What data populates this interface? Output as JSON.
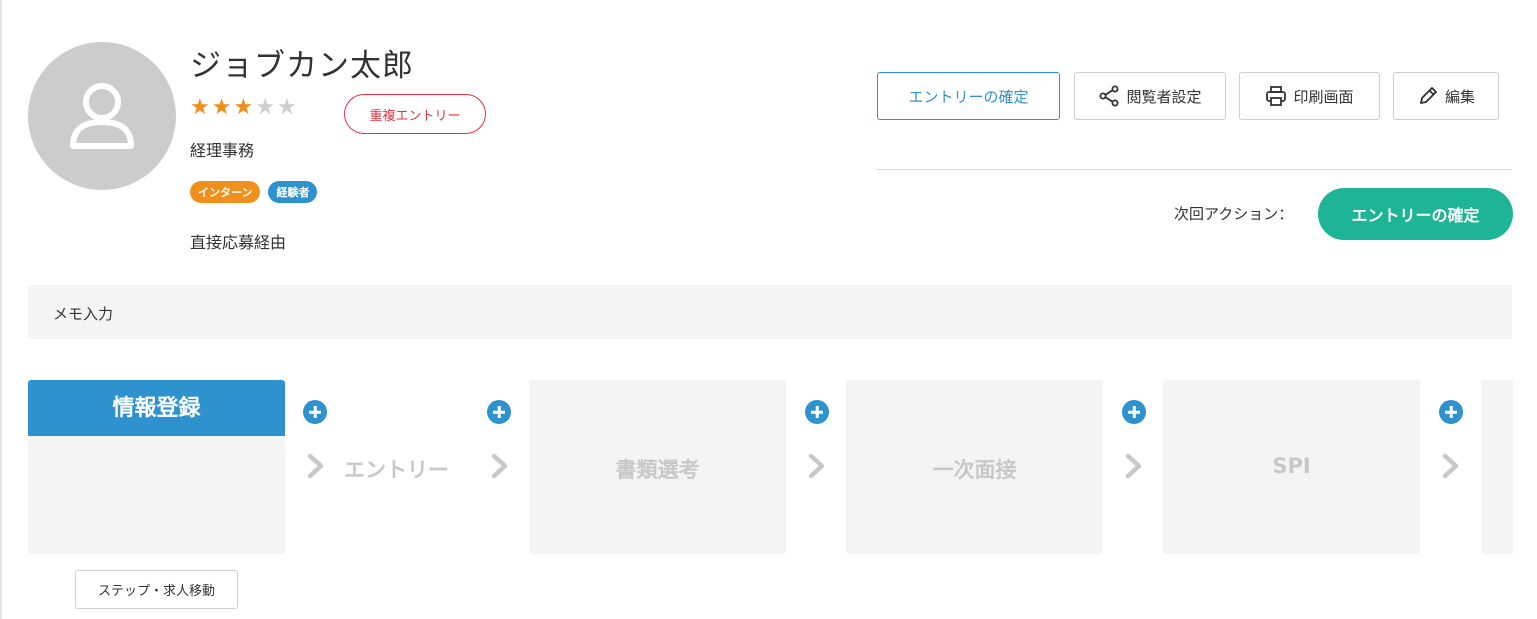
{
  "candidate": {
    "name": "ジョブカン太郎",
    "rating": 3,
    "rating_max": 5,
    "duplicate_badge": "重複エントリー",
    "job": "経理事務",
    "tags": [
      "インターン",
      "経験者"
    ],
    "source": "直接応募経由"
  },
  "actions": {
    "confirm_entry": "エントリーの確定",
    "viewer_settings": "閲覧者設定",
    "print_screen": "印刷画面",
    "edit": "編集"
  },
  "next_action": {
    "label": "次回アクション：",
    "button": "エントリーの確定"
  },
  "memo": {
    "label": "メモ入力"
  },
  "steps": {
    "info": "情報登録",
    "entry": "エントリー",
    "documents": "書類選考",
    "first_interview": "一次面接",
    "spi": "SPI"
  },
  "move_button": "ステップ・求人移動",
  "colors": {
    "accent_blue": "#2e92cf",
    "next_green": "#1db595",
    "star_orange": "#f0901c",
    "duplicate_red": "#e8303f"
  }
}
